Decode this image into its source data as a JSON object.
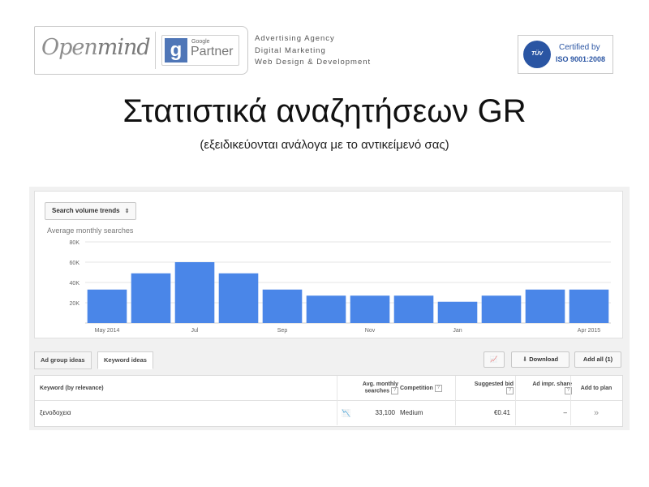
{
  "header": {
    "logo_text_open": "Open",
    "logo_text_mind": "mind",
    "google_small": "Google",
    "google_partner": "Partner",
    "agency_lines": [
      "Advertising Agency",
      "Digital Marketing",
      "Web Design & Development"
    ],
    "iso_badge": "TÜV",
    "iso_certified": "Certified by",
    "iso_standard": "ISO 9001:2008"
  },
  "title": "Στατιστικά αναζητήσεων GR",
  "subtitle": "(εξειδικεύονται ανάλογα με το αντικείμενό σας)",
  "chart_controls": {
    "select_label": "Search volume trends",
    "avg_label": "Average monthly searches"
  },
  "colors": {
    "bar": "#4a86e8",
    "grid": "#e5e5e5"
  },
  "chart_data": {
    "type": "bar",
    "title": "",
    "ylabel": "Average monthly searches",
    "ylim": [
      0,
      80000
    ],
    "yticks": [
      20000,
      40000,
      60000,
      80000
    ],
    "ytick_labels": [
      "20K",
      "40K",
      "60K",
      "80K"
    ],
    "categories": [
      "May 2014",
      "Jun 2014",
      "Jul 2014",
      "Aug 2014",
      "Sep 2014",
      "Oct 2014",
      "Nov 2014",
      "Dec 2014",
      "Jan 2015",
      "Feb 2015",
      "Mar 2015",
      "Apr 2015"
    ],
    "xtick_labels": [
      "May 2014",
      "",
      "Jul",
      "",
      "Sep",
      "",
      "Nov",
      "",
      "Jan",
      "",
      "",
      "Apr 2015"
    ],
    "values": [
      33000,
      49000,
      60000,
      49000,
      33000,
      27000,
      27000,
      27000,
      21000,
      27000,
      33000,
      33000
    ]
  },
  "tabs": [
    {
      "label": "Ad group ideas"
    },
    {
      "label": "Keyword ideas"
    }
  ],
  "toolbar": {
    "download_label": "Download",
    "add_all_label": "Add all (1)"
  },
  "table": {
    "headers": {
      "keyword": "Keyword (by relevance)",
      "avg_line1": "Avg. monthly",
      "avg_line2": "searches",
      "competition": "Competition",
      "bid_line1": "Suggested bid",
      "share_line1": "Ad impr. share",
      "add": "Add to plan",
      "help": "?"
    },
    "rows": [
      {
        "keyword": "ξενοδοχεια",
        "searches": "33,100",
        "competition": "Medium",
        "bid": "€0.41",
        "share": "–",
        "add": "»"
      }
    ]
  }
}
